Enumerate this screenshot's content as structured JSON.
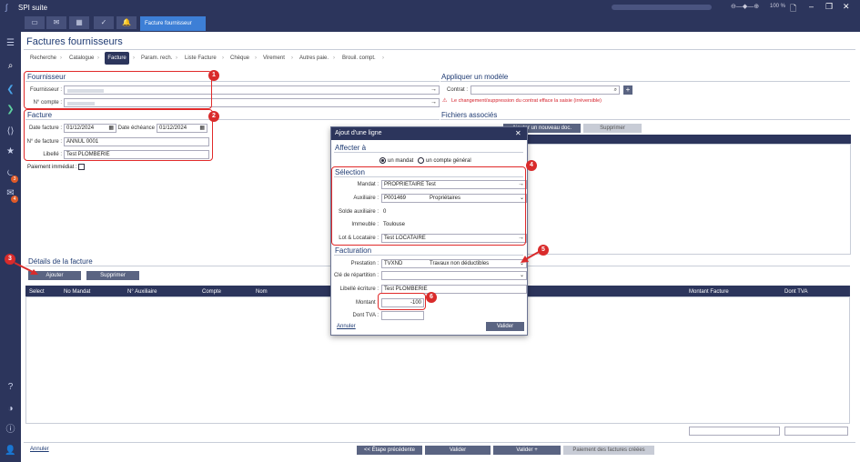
{
  "app": {
    "title": "SPI suite",
    "active_tab": "Facture fournisseur",
    "zoom": "100 %"
  },
  "page": {
    "title": "Factures fournisseurs"
  },
  "breadcrumb": [
    "Recherche",
    "Catalogue",
    "Facture",
    "Param. rech.",
    "Liste Facture",
    "Chèque",
    "Virement",
    "Autres paie.",
    "Brouil. compt."
  ],
  "fournisseur": {
    "section": "Fournisseur",
    "fournisseur_label": "Fournisseur :",
    "compte_label": "N° compte :"
  },
  "facture": {
    "section": "Facture",
    "date_label": "Date facture :",
    "date_value": "01/12/2024",
    "echeance_label": "Date échéance",
    "echeance_value": "01/12/2024",
    "num_label": "N° de facture :",
    "num_value": "ANNUL 0001",
    "libelle_label": "Libellé :",
    "libelle_value": "Test PLOMBERIE",
    "paiement_label": "Paiement immédiat :"
  },
  "modele": {
    "section": "Appliquer un modèle",
    "contrat_label": "Contrat :",
    "warning": "Le changement/suppression du contrat efface la saisie (irréversible)"
  },
  "fichiers": {
    "section": "Fichiers associés",
    "add_doc": "Ajouter un nouveau doc.",
    "delete": "Supprimer"
  },
  "details": {
    "section": "Détails de la facture",
    "add": "Ajouter",
    "delete": "Supprimer",
    "columns": [
      "Select",
      "No Mandat",
      "N° Auxiliaire",
      "Compte",
      "Nom",
      "Montant Facture",
      "Dont TVA"
    ]
  },
  "footer": {
    "cancel": "Annuler",
    "prev": "<< Étape précédente",
    "validate": "Valider",
    "validate_plus": "Valider +",
    "paiement": "Paiement des factures créées"
  },
  "dialog": {
    "title": "Ajout d'une ligne",
    "close": "✕",
    "affecter": "Affecter à",
    "radio_mandat": "un mandat",
    "radio_compte": "un compte général",
    "selection": "Sélection",
    "mandat_label": "Mandat :",
    "mandat_value": "PROPRIETAIRE Test",
    "auxiliaire_label": "Auxiliaire :",
    "auxiliaire_code": "P001469",
    "auxiliaire_type": "Propriétaires",
    "solde_label": "Solde auxiliaire :",
    "solde_value": "0",
    "immeuble_label": "Immeuble :",
    "immeuble_value": "Toulouse",
    "lot_label": "Lot & Locataire :",
    "lot_value": "Test LOCATAIRE",
    "facturation": "Facturation",
    "prestation_label": "Prestation :",
    "prestation_code": "TVXND",
    "prestation_value": "Travaux non déductibles",
    "cle_label": "Clé de répartition :",
    "libelle_label": "Libellé écriture :",
    "libelle_value": "Test PLOMBERIE",
    "montant_label": "Montant :",
    "montant_value": "-100",
    "tva_label": "Dont TVA :",
    "cancel": "Annuler",
    "validate": "Valider"
  },
  "callouts": [
    "1",
    "2",
    "3",
    "4",
    "5",
    "6"
  ]
}
